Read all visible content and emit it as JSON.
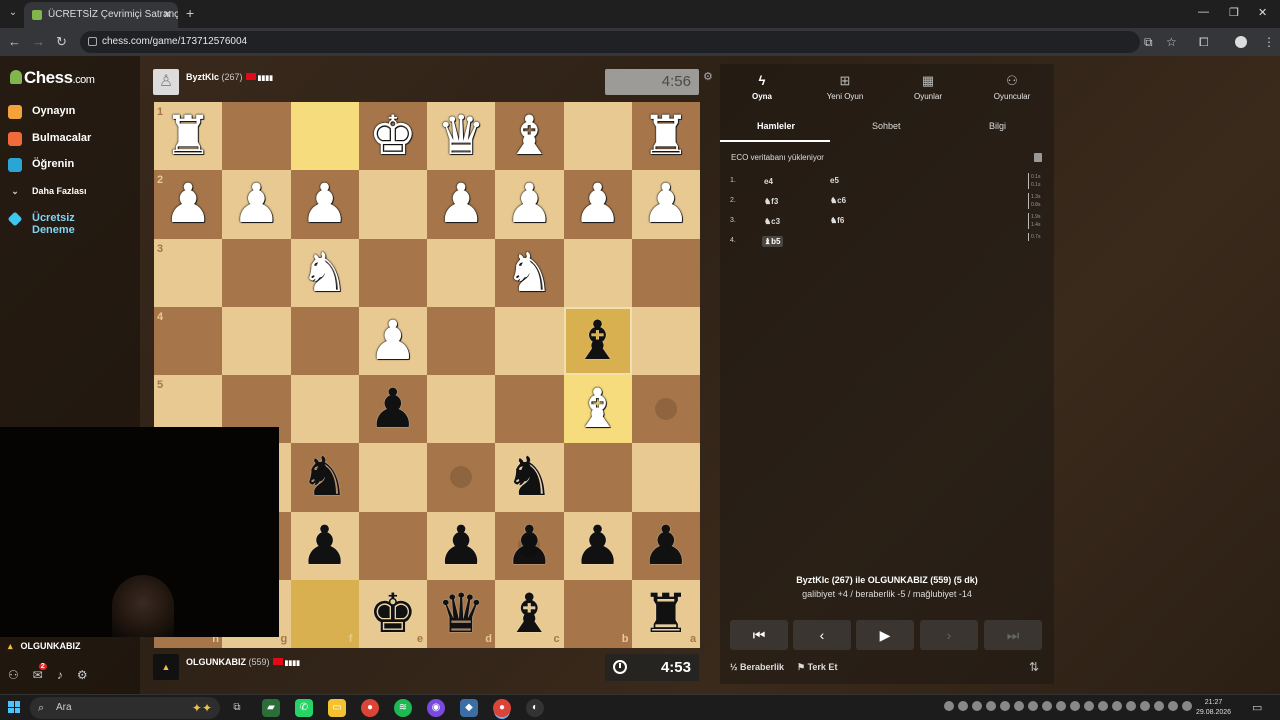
{
  "browser": {
    "tab_title": "ÜCRETSİZ Çevrimiçi Satranç Oy",
    "url": "chess.com/game/173712576004"
  },
  "sidebar": {
    "logo": "Chess",
    "logo_suffix": ".com",
    "items": [
      {
        "label": "Oynayın",
        "icon": "pawn-play-icon",
        "color": "#f3a33a"
      },
      {
        "label": "Bulmacalar",
        "icon": "puzzle-icon",
        "color": "#f06a3a"
      },
      {
        "label": "Öğrenin",
        "icon": "learn-icon",
        "color": "#29a6d6"
      },
      {
        "label": "Daha Fazlası",
        "icon": "chevron-down-icon",
        "color": "#cccccc"
      },
      {
        "label": "Ücretsiz Deneme",
        "icon": "diamond-icon",
        "color": "#3fc6f0"
      }
    ],
    "username": "OLGUNKABIZ",
    "notification_count": "2"
  },
  "top_player": {
    "name": "ByztKlc",
    "rating": "(267)",
    "clock": "4:56"
  },
  "bottom_player": {
    "name": "OLGUNKABIZ",
    "rating": "(559)",
    "clock": "4:53"
  },
  "board": {
    "orientation": "black",
    "rank_labels": [
      "1",
      "2",
      "3",
      "4",
      "5"
    ],
    "file_labels": [
      "h",
      "g",
      "f",
      "e",
      "d",
      "c",
      "b",
      "a"
    ]
  },
  "panel": {
    "tabs": [
      {
        "label": "Oyna",
        "icon": "lightning-icon"
      },
      {
        "label": "Yeni Oyun",
        "icon": "plus-icon"
      },
      {
        "label": "Oyunlar",
        "icon": "board-icon"
      },
      {
        "label": "Oyuncular",
        "icon": "players-icon"
      }
    ],
    "subtabs": [
      "Hamleler",
      "Sohbet",
      "Bilgi"
    ],
    "eco_text": "ECO veritabanı yükleniyor",
    "moves": [
      {
        "num": "1.",
        "white": "e4",
        "black": "e5",
        "times": [
          "0.1s",
          "0.1s"
        ]
      },
      {
        "num": "2.",
        "white": "♞f3",
        "black": "♞c6",
        "times": [
          "1.3s",
          "0.8s"
        ]
      },
      {
        "num": "3.",
        "white": "♞c3",
        "black": "♞f6",
        "times": [
          "1.9s",
          "1.4s"
        ]
      },
      {
        "num": "4.",
        "white": "♝b5",
        "black": "",
        "times": [
          "0.7s"
        ]
      }
    ],
    "result_players": "ByztKlc (267) ile OLGUNKABIZ (559) (5 dk)",
    "result_stats": "galibiyet +4 / beraberlik -5 / mağlubiyet -14",
    "draw_label": "Beraberlik",
    "resign_label": "Terk Et"
  },
  "taskbar": {
    "search_placeholder": "Ara",
    "time": "21:27",
    "date": "29.08.2026"
  }
}
